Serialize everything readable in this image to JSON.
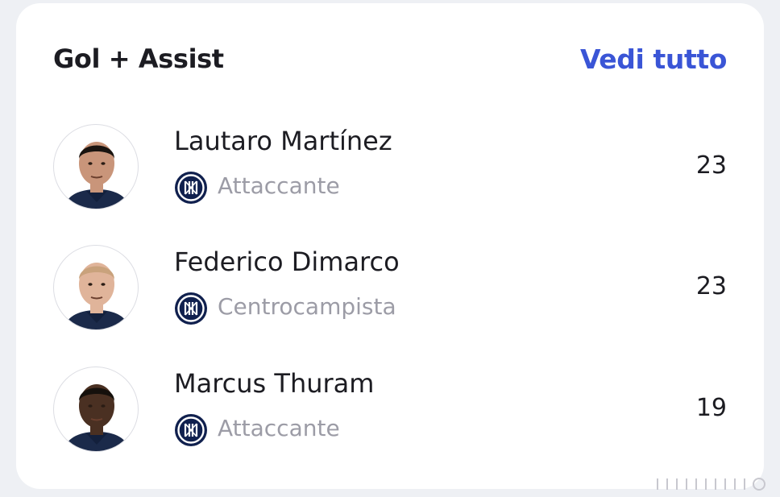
{
  "theme": {
    "accent": "#3a55d6"
  },
  "card": {
    "title": "Gol + Assist",
    "see_all_label": "Vedi tutto"
  },
  "players": [
    {
      "name": "Lautaro Martínez",
      "role": "Attaccante",
      "value": "23",
      "skin": "#c9957a",
      "hair": "#1a1410"
    },
    {
      "name": "Federico Dimarco",
      "role": "Centrocampista",
      "value": "23",
      "skin": "#e0b49a",
      "hair": "#c9a27c"
    },
    {
      "name": "Marcus Thuram",
      "role": "Attaccante",
      "value": "19",
      "skin": "#4a3022",
      "hair": "#15100c"
    }
  ]
}
